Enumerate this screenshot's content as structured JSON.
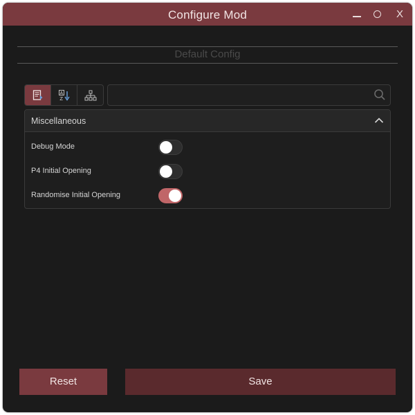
{
  "window": {
    "title": "Configure Mod",
    "controls": {
      "close_label": "X"
    },
    "accent_color": "#7a3a3f"
  },
  "config": {
    "title": "Default Config"
  },
  "toolbar": {
    "buttons": [
      {
        "icon": "document-icon",
        "active": true
      },
      {
        "icon": "sort-az-icon",
        "active": false
      },
      {
        "icon": "hierarchy-icon",
        "active": false
      }
    ]
  },
  "search": {
    "placeholder": "",
    "value": "",
    "icon": "search-icon"
  },
  "section": {
    "title": "Miscellaneous",
    "expanded": true,
    "settings": [
      {
        "label": "Debug Mode",
        "enabled": false
      },
      {
        "label": "P4 Initial Opening",
        "enabled": false
      },
      {
        "label": "Randomise Initial Opening",
        "enabled": true
      }
    ],
    "toggle_on_color": "#c06668"
  },
  "footer": {
    "reset_label": "Reset",
    "save_label": "Save"
  }
}
